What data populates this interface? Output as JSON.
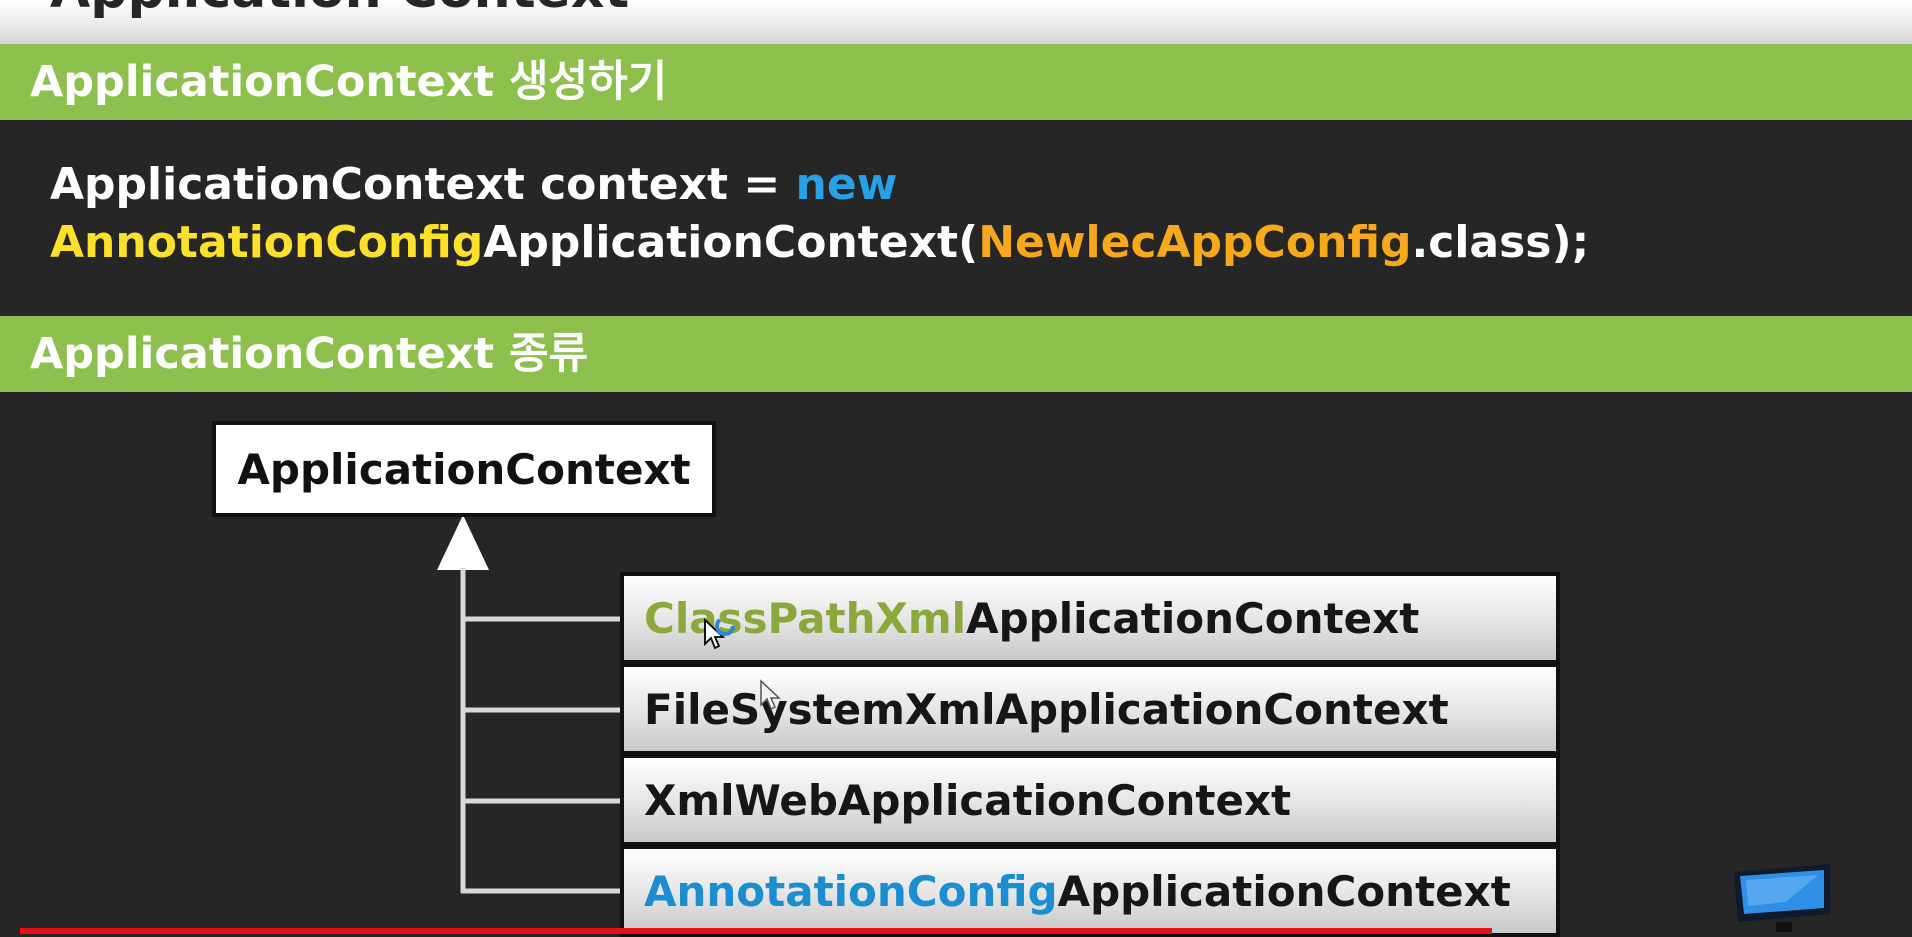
{
  "slide": {
    "title": "Application Context",
    "section1": {
      "heading": "ApplicationContext 생성하기"
    },
    "code": {
      "line1": {
        "text": "ApplicationContext context = ",
        "keyword": "new"
      },
      "line2": {
        "prefix": "AnnotationConfig",
        "middle": "ApplicationContext(",
        "config_class": "NewlecAppConfig",
        "suffix": ".class);"
      }
    },
    "section2": {
      "heading": "ApplicationContext 종류"
    },
    "hierarchy": {
      "root": "ApplicationContext",
      "implementations": [
        {
          "prefix": "ClassPathXml",
          "rest": "ApplicationContext"
        },
        {
          "prefix": "",
          "rest": "FileSystemXmlApplicationContext"
        },
        {
          "prefix": "",
          "rest": "XmlWebApplicationContext"
        },
        {
          "prefix": "AnnotationConfig",
          "rest": "ApplicationContext"
        }
      ]
    }
  },
  "colors": {
    "header_bar": "#8cbf4c",
    "background": "#262626",
    "keyword_new": "#2aa0e6",
    "annotation_yellow": "#fde02b",
    "config_orange": "#f7a81b",
    "classpath_olive": "#8aa83c",
    "annotation_blue": "#1a8ed0",
    "progress_red": "#e6101a"
  },
  "video": {
    "progress": 0.77
  },
  "icons": [
    "mouse-cursor-icon",
    "loading-spinner-icon",
    "monitor-logo-icon"
  ]
}
